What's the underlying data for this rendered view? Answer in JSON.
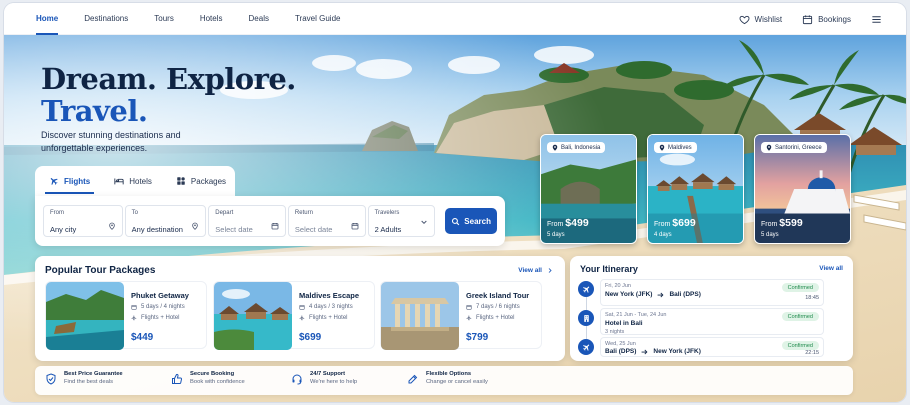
{
  "nav": {
    "links": [
      "Home",
      "Destinations",
      "Tours",
      "Hotels",
      "Deals",
      "Travel Guide"
    ],
    "wishlist": "Wishlist",
    "bookings": "Bookings"
  },
  "hero": {
    "title_line1": "Dream. Explore.",
    "title_line2": "Travel.",
    "subtitle": "Discover stunning destinations and unforgettable experiences."
  },
  "search": {
    "tabs": [
      "Flights",
      "Hotels",
      "Packages"
    ],
    "from_label": "From",
    "from_value": "Any city",
    "to_label": "To",
    "to_value": "Any destination",
    "depart_label": "Depart",
    "depart_placeholder": "Select date",
    "return_label": "Return",
    "return_placeholder": "Select date",
    "travelers_label": "Travelers",
    "travelers_value": "2 Adults",
    "button": "Search"
  },
  "destinations": [
    {
      "place": "Bali, Indonesia",
      "from": "From",
      "price": "$499",
      "days": "5 days"
    },
    {
      "place": "Maldives",
      "from": "From",
      "price": "$699",
      "days": "4 days"
    },
    {
      "place": "Santorini, Greece",
      "from": "From",
      "price": "$599",
      "days": "5 days"
    }
  ],
  "packages": {
    "title": "Popular Tour Packages",
    "view_all": "View all",
    "items": [
      {
        "name": "Phuket Getaway",
        "duration": "5 days / 4 nights",
        "includes": "Flights + Hotel",
        "price": "$449"
      },
      {
        "name": "Maldives Escape",
        "duration": "4 days / 3 nights",
        "includes": "Flights + Hotel",
        "price": "$699"
      },
      {
        "name": "Greek Island Tour",
        "duration": "7 days / 6 nights",
        "includes": "Flights + Hotel",
        "price": "$799"
      }
    ]
  },
  "itinerary": {
    "title": "Your Itinerary",
    "view_all": "View all",
    "items": [
      {
        "date": "Fri, 20 Jun",
        "from": "New York (JFK)",
        "to": "Bali (DPS)",
        "status": "Confirmed",
        "time": "18:45"
      },
      {
        "date": "Sat, 21 Jun - Tue, 24 Jun",
        "hotel": "Hotel in Bali",
        "sub": "3 nights",
        "status": "Confirmed"
      },
      {
        "date": "Wed, 25 Jun",
        "from": "Bali (DPS)",
        "to": "New York (JFK)",
        "status": "Confirmed",
        "time": "22:15"
      }
    ]
  },
  "features": [
    {
      "title": "Best Price Guarantee",
      "sub": "Find the best deals"
    },
    {
      "title": "Secure Booking",
      "sub": "Book with confidence"
    },
    {
      "title": "24/7 Support",
      "sub": "We're here to help"
    },
    {
      "title": "Flexible Options",
      "sub": "Change or cancel easily"
    }
  ],
  "colors": {
    "accent": "#1a56b8",
    "heading": "#0f2444",
    "confirmed_bg": "#dff3e6",
    "confirmed_text": "#1f8a4c"
  }
}
